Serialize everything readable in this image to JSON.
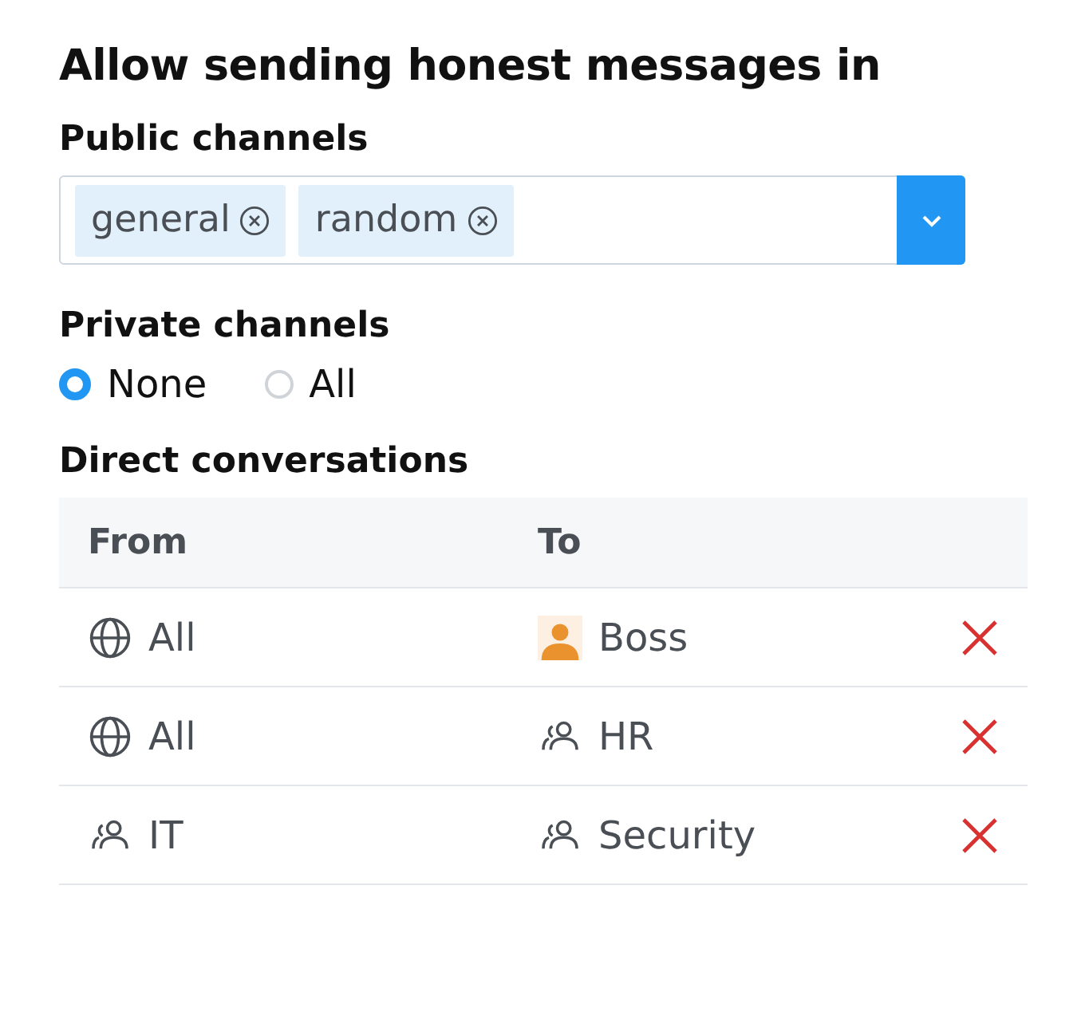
{
  "title": "Allow sending honest messages in",
  "public_channels": {
    "label": "Public channels",
    "tags": [
      "general",
      "random"
    ]
  },
  "private_channels": {
    "label": "Private channels",
    "options": [
      {
        "label": "None",
        "selected": true
      },
      {
        "label": "All",
        "selected": false
      }
    ]
  },
  "direct_conversations": {
    "label": "Direct conversations",
    "columns": [
      "From",
      "To"
    ],
    "rows": [
      {
        "from": {
          "kind": "everyone",
          "text": "All"
        },
        "to": {
          "kind": "user",
          "text": "Boss"
        }
      },
      {
        "from": {
          "kind": "everyone",
          "text": "All"
        },
        "to": {
          "kind": "group",
          "text": "HR"
        }
      },
      {
        "from": {
          "kind": "group",
          "text": "IT"
        },
        "to": {
          "kind": "group",
          "text": "Security"
        }
      }
    ]
  }
}
